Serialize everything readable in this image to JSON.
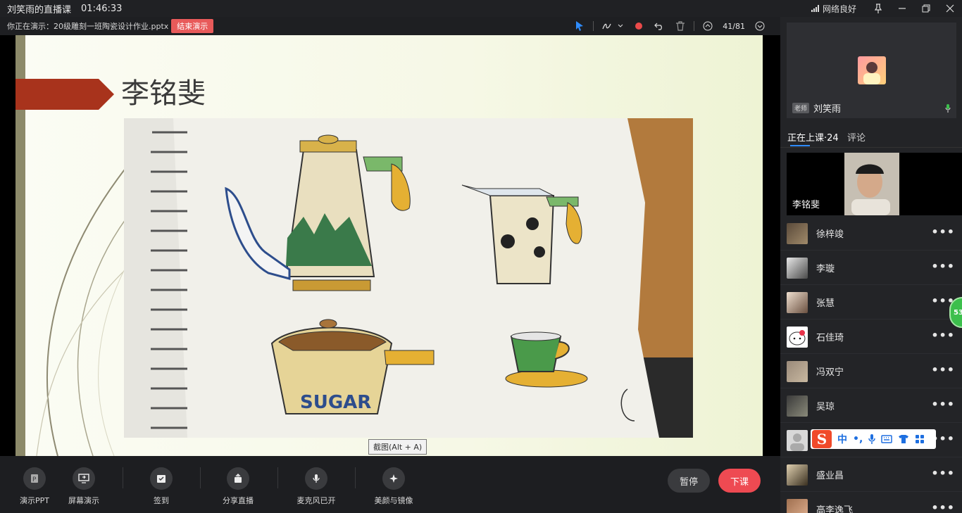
{
  "titlebar": {
    "title": "刘笑雨的直播课",
    "time": "01:46:33",
    "network": "网络良好"
  },
  "presentbar": {
    "presenting_label": "你正在演示：20级雕刻一班陶瓷设计作业.pptx",
    "end_button": "结束演示",
    "page_indicator": "41/81"
  },
  "slide": {
    "student_name": "李铭斐",
    "tooltip": "截图(Alt + A)"
  },
  "toolbar": {
    "items": [
      {
        "label": "演示PPT",
        "icon": "ppt-icon"
      },
      {
        "label": "屏幕演示",
        "icon": "screen-share-icon"
      },
      {
        "label": "签到",
        "icon": "checkin-icon"
      },
      {
        "label": "分享直播",
        "icon": "share-icon"
      },
      {
        "label": "麦克风已开",
        "icon": "microphone-icon"
      },
      {
        "label": "美颜与镜像",
        "icon": "beauty-icon"
      }
    ],
    "pause_label": "暂停",
    "end_class_label": "下课"
  },
  "panel": {
    "teacher_badge": "老师",
    "teacher_name": "刘笑雨",
    "tab_live": "正在上课·24",
    "tab_comments": "评论",
    "featured_name": "李铭斐",
    "students": [
      {
        "name": "徐梓竣"
      },
      {
        "name": "李璇"
      },
      {
        "name": "张慧"
      },
      {
        "name": "石佳琦"
      },
      {
        "name": "冯双宁"
      },
      {
        "name": "吴琼"
      },
      {
        "name": ""
      },
      {
        "name": "盛业昌"
      },
      {
        "name": "高李逸飞"
      }
    ],
    "more_label": "•••"
  },
  "ime": {
    "items": [
      "中",
      "•,"
    ]
  },
  "bubble_count": "53",
  "colors": {
    "accent": "#2f8cff",
    "danger": "#ee4a52",
    "end_present": "#e85a5a"
  }
}
